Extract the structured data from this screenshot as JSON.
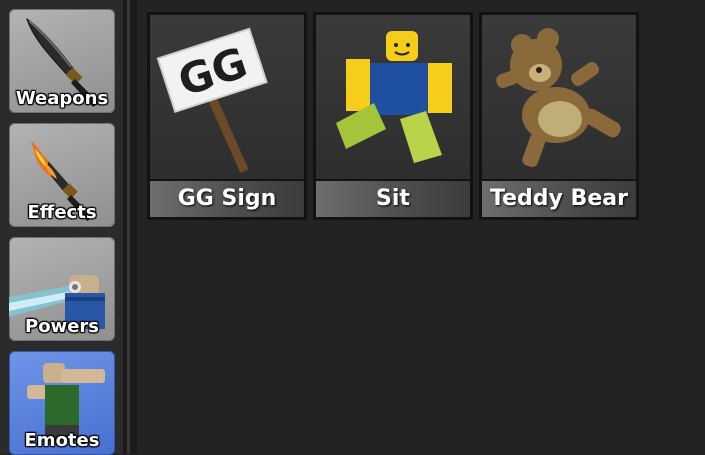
{
  "sidebar": {
    "categories": [
      {
        "label": "Weapons",
        "icon": "knife-icon",
        "active": false
      },
      {
        "label": "Effects",
        "icon": "flaming-knife-icon",
        "active": false
      },
      {
        "label": "Powers",
        "icon": "power-beam-icon",
        "active": false
      },
      {
        "label": "Emotes",
        "icon": "dab-figure-icon",
        "active": true
      }
    ]
  },
  "items": [
    {
      "label": "GG Sign",
      "icon": "gg-sign-icon",
      "sign_text": "GG"
    },
    {
      "label": "Sit",
      "icon": "sitting-figure-icon"
    },
    {
      "label": "Teddy Bear",
      "icon": "teddy-bear-icon"
    }
  ],
  "colors": {
    "background": "#232323",
    "active_category": "#5a82e0",
    "inactive_category": "#a3a3a3"
  }
}
